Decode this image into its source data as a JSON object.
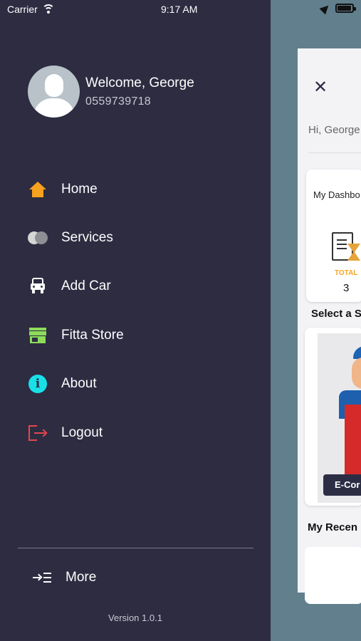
{
  "status_bar": {
    "carrier": "Carrier",
    "time": "9:17 AM"
  },
  "profile": {
    "welcome": "Welcome, George",
    "phone": "0559739718"
  },
  "menu": {
    "items": [
      {
        "label": "Home",
        "icon": "home-icon",
        "color": "#f7a11f"
      },
      {
        "label": "Services",
        "icon": "services-icon",
        "color": "#d5d5d5"
      },
      {
        "label": "Add Car",
        "icon": "car-icon",
        "color": "#ffffff"
      },
      {
        "label": "Fitta Store",
        "icon": "store-icon",
        "color": "#8ddc5a"
      },
      {
        "label": "About",
        "icon": "info-icon",
        "color": "#19e0e8"
      },
      {
        "label": "Logout",
        "icon": "logout-icon",
        "color": "#e5484d"
      }
    ]
  },
  "footer": {
    "more_label": "More",
    "version": "Version 1.0.1"
  },
  "background_app": {
    "greeting": "Hi, George",
    "dashboard_title": "My Dashbo",
    "total_label": "TOTAL",
    "total_count": "3",
    "select_text": "Select a S",
    "ecommerce_button": "E-Cor",
    "recent_text": "My Recen"
  },
  "colors": {
    "drawer_bg": "#2d2c41",
    "backdrop": "#617f8c",
    "accent_orange": "#f7a11f"
  }
}
